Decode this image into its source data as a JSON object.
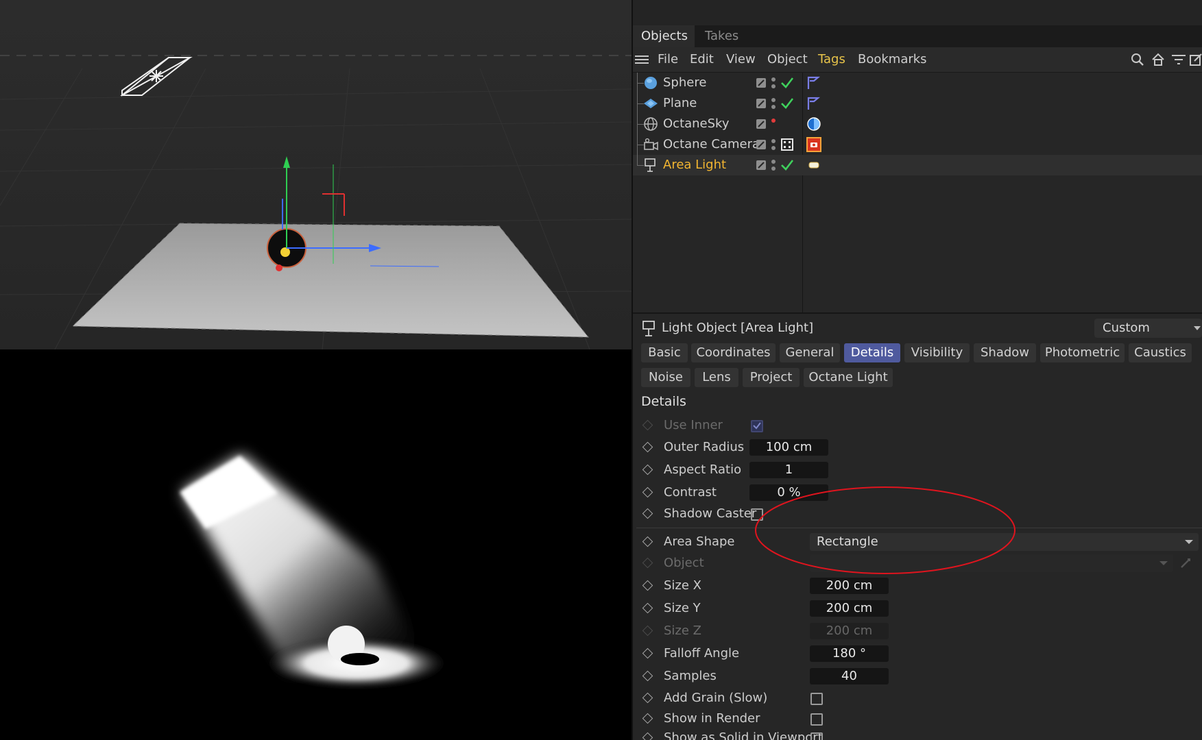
{
  "tabs": [
    {
      "label": "Objects",
      "active": true
    },
    {
      "label": "Takes",
      "active": false
    }
  ],
  "menu": [
    "File",
    "Edit",
    "View",
    "Object",
    "Tags",
    "Bookmarks"
  ],
  "menu_highlight": "Tags",
  "toolbar_icons": [
    "search-icon",
    "home-icon",
    "filter-icon",
    "new-window-icon"
  ],
  "objects": [
    {
      "name": "Sphere",
      "icon": "sphere-icon",
      "status": "check",
      "tag": "phong-tag-icon",
      "selected": false
    },
    {
      "name": "Plane",
      "icon": "plane-icon",
      "status": "check",
      "tag": "phong-tag-icon",
      "selected": false
    },
    {
      "name": "OctaneSky",
      "icon": "sky-icon",
      "status": "none",
      "tag": "environment-tag-icon",
      "selected": false
    },
    {
      "name": "Octane Camera",
      "icon": "camera-icon",
      "status": "target",
      "tag": "camera-tag-icon",
      "selected": false
    },
    {
      "name": "Area Light",
      "icon": "light-icon",
      "status": "check",
      "tag": "light-tag-icon",
      "selected": true
    }
  ],
  "attributes": {
    "title": "Light Object [Area Light]",
    "mode": "Custom",
    "tabs_row1": [
      "Basic",
      "Coordinates",
      "General",
      "Details",
      "Visibility",
      "Shadow",
      "Photometric",
      "Caustics"
    ],
    "tabs_row2": [
      "Noise",
      "Lens",
      "Project",
      "Octane Light"
    ],
    "active_tab": "Details",
    "section": "Details",
    "params": {
      "use_inner": {
        "label": "Use Inner",
        "checked": true
      },
      "outer_radius": {
        "label": "Outer Radius",
        "value": "100 cm"
      },
      "aspect_ratio": {
        "label": "Aspect Ratio",
        "value": "1"
      },
      "contrast": {
        "label": "Contrast",
        "value": "0 %"
      },
      "shadow_caster": {
        "label": "Shadow Caster",
        "checked": false
      },
      "area_shape": {
        "label": "Area Shape",
        "value": "Rectangle"
      },
      "object": {
        "label": "Object",
        "value": ""
      },
      "size_x": {
        "label": "Size X",
        "value": "200 cm"
      },
      "size_y": {
        "label": "Size Y",
        "value": "200 cm"
      },
      "size_z": {
        "label": "Size Z",
        "value": "200 cm"
      },
      "falloff_angle": {
        "label": "Falloff Angle",
        "value": "180 °"
      },
      "samples": {
        "label": "Samples",
        "value": "40"
      },
      "add_grain": {
        "label": "Add Grain (Slow)",
        "checked": false
      },
      "show_in_render": {
        "label": "Show in Render",
        "checked": false
      },
      "show_as_solid": {
        "label": "Show as Solid in Viewport",
        "checked": false
      }
    }
  },
  "colors": {
    "accent_tab": "#4f5a9e",
    "active_object": "#f2b531",
    "annotation": "#e0141e"
  }
}
